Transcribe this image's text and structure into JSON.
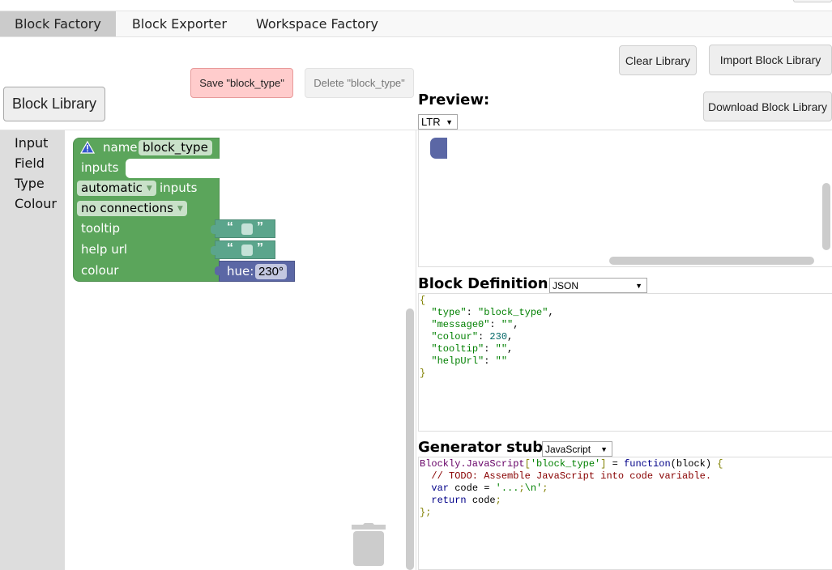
{
  "tabs": [
    {
      "label": "Block Factory",
      "active": true
    },
    {
      "label": "Block Exporter",
      "active": false
    },
    {
      "label": "Workspace Factory",
      "active": false
    }
  ],
  "buttons": {
    "save": "Save \"block_type\"",
    "delete": "Delete \"block_type\"",
    "block_library": "Block Library",
    "clear_library": "Clear Library",
    "import_library": "Import Block Library",
    "download_library": "Download Block Library"
  },
  "toolbox": {
    "categories": [
      "Input",
      "Field",
      "Type",
      "Colour"
    ]
  },
  "block": {
    "name_label": "name",
    "name_value": "block_type",
    "inputs_label": "inputs",
    "inputs_mode": "automatic",
    "inputs_suffix": "inputs",
    "connections": "no connections",
    "tooltip_label": "tooltip",
    "helpurl_label": "help url",
    "colour_label": "colour",
    "hue_label": "hue:",
    "hue_value": "230°",
    "quote_open": "“",
    "quote_close": "”",
    "colours": {
      "main": "#5ba55b",
      "text": "#5ba58c",
      "colour": "#5b67a5"
    }
  },
  "preview": {
    "heading": "Preview:",
    "direction": "LTR"
  },
  "definition": {
    "heading": "Block Definition:",
    "format": "JSON",
    "lines": [
      "{",
      "  \"type\": \"block_type\",",
      "  \"message0\": \"\",",
      "  \"colour\": 230,",
      "  \"tooltip\": \"\",",
      "  \"helpUrl\": \"\"",
      "}"
    ]
  },
  "generator": {
    "heading": "Generator stub:",
    "language": "JavaScript",
    "lines": [
      "Blockly.JavaScript['block_type'] = function(block) {",
      "  // TODO: Assemble JavaScript into code variable.",
      "  var code = '...;\\n';",
      "  return code;",
      "};"
    ]
  }
}
